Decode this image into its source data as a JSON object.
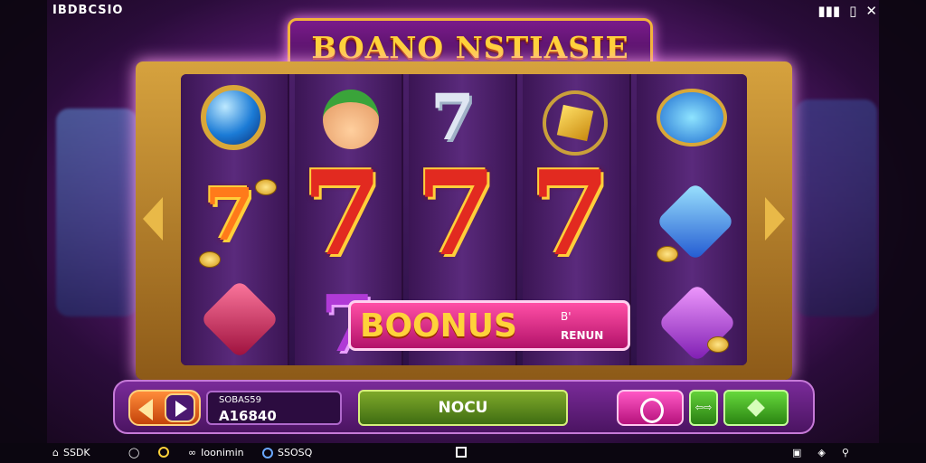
{
  "app": {
    "title": "IBDBCSIO"
  },
  "topbar": {
    "signal_icon": "signal-icon",
    "battery_icon": "battery-icon",
    "close_label": "✕"
  },
  "marquee": {
    "title": "BOANO NSTIASIE"
  },
  "bonus": {
    "label": "BOONUS",
    "sub1": "B'",
    "sub2": "RENUN"
  },
  "panel": {
    "info_label": "SOBAS59",
    "info_value": "A16840",
    "center_label": "NOCU",
    "small_button_label": "⇦⇨"
  },
  "bottombar": {
    "items": [
      "SSDK",
      "Ioonimin",
      "SSOSQ"
    ]
  },
  "colors": {
    "accent": "#ffd23a",
    "frame": "#d6a23e",
    "bonus": "#ff4fa6",
    "panel": "#7a2b9a"
  }
}
